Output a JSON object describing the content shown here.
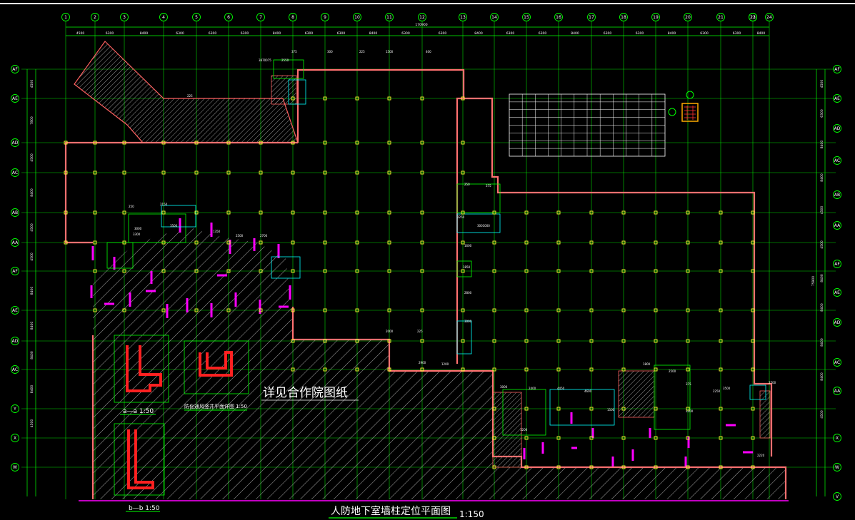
{
  "colors": {
    "background": "#000000",
    "grid_line": "#00ff00",
    "wall": "#ff6060",
    "wall_fill": "#ff9a9a",
    "hatch": "#bbbbbb",
    "column": "#ffff33",
    "magenta": "#ff00ff",
    "red_detail": "#ff2020",
    "text": "#ffffff",
    "title_underline": "#00ff00"
  },
  "axes": {
    "vertical": [
      "1",
      "2",
      "3",
      "4",
      "5",
      "6",
      "7",
      "8",
      "9",
      "10",
      "11",
      "12",
      "13",
      "14",
      "15",
      "16",
      "17",
      "18",
      "19",
      "20",
      "21",
      "22",
      "23",
      "24"
    ],
    "horizontal": [
      "AF",
      "AE",
      "AD",
      "AC",
      "AB",
      "AA",
      "Y",
      "X",
      "W",
      "V"
    ],
    "left_side": [
      "AF",
      "AE",
      "AD",
      "AC",
      "AB",
      "AA",
      "Y",
      "X",
      "W"
    ],
    "right_side": [
      "AF",
      "AE",
      "AD",
      "AC",
      "AB",
      "AA",
      "Y",
      "X",
      "W",
      "V"
    ],
    "top_dimensions": [
      "4500",
      "6300",
      "8400",
      "6300",
      "6300",
      "6300",
      "8400",
      "6300",
      "6300",
      "8400",
      "6300",
      "6300",
      "8400",
      "6300",
      "6300",
      "8400",
      "6300",
      "6300",
      "8400",
      "6300",
      "6300",
      "8400",
      "6300"
    ],
    "total_dimension": "170900",
    "left_dimensions": [
      "4500",
      "7800",
      "4500",
      "8400",
      "4500",
      "4500",
      "8400",
      "8400",
      "8400",
      "8400",
      "4500"
    ],
    "right_dimensions": [
      "4500",
      "6300",
      "8400",
      "8400",
      "4500",
      "4500",
      "8400",
      "8400",
      "8400",
      "8400",
      "4500"
    ],
    "right_total": "75900"
  },
  "labels": {
    "detail_note": "详见合作院图纸",
    "main_title": "人防地下室墙柱定位平面图",
    "main_scale": "1:150",
    "section_a": "a—a 1:50",
    "section_b": "b—b 1:50",
    "section_c": "防化通风竖井平面详图 1:50"
  },
  "annotations": [
    "2550",
    "375",
    "225",
    "3870075",
    "300",
    "225",
    "1500",
    "400",
    "250",
    "2150",
    "3000",
    "3500",
    "1350",
    "2500",
    "2700",
    "3300",
    "250",
    "375",
    "2250",
    "3001000",
    "1600",
    "1850",
    "2800",
    "3000",
    "2000",
    "225",
    "2900",
    "1200",
    "3000",
    "2400",
    "4450",
    "4600",
    "1500",
    "1800",
    "2500",
    "375",
    "3300",
    "2250",
    "3500",
    "2700",
    "2220",
    "1200"
  ]
}
